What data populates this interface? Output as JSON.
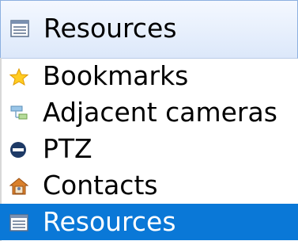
{
  "combo": {
    "selected_label": "Resources",
    "icon": "resources-icon"
  },
  "menu": {
    "items": [
      {
        "label": "Bookmarks",
        "icon": "star-icon",
        "selected": false
      },
      {
        "label": "Adjacent cameras",
        "icon": "adjacent-cameras-icon",
        "selected": false
      },
      {
        "label": "PTZ",
        "icon": "ptz-icon",
        "selected": false
      },
      {
        "label": "Contacts",
        "icon": "contacts-icon",
        "selected": false
      },
      {
        "label": "Resources",
        "icon": "resources-icon",
        "selected": true
      }
    ]
  },
  "colors": {
    "selection": "#0a78d7",
    "combo_border": "#8cb0e0"
  }
}
